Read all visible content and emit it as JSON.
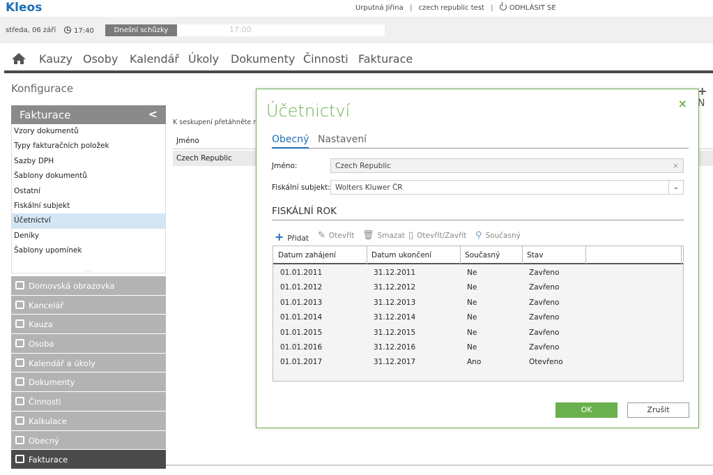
{
  "app": {
    "logo": "Kleos"
  },
  "header": {
    "user": "Urputná Jiřina",
    "org": "czech republic test",
    "logout": "ODHLÁSIT SE",
    "date": "středa, 06 září",
    "time": "17:40",
    "meetings_label": "Dnešní schůzky",
    "meetings_time": "17:00"
  },
  "nav": {
    "items": [
      "Kauzy",
      "Osoby",
      "Kalendář",
      "Úkoly",
      "Dokumenty",
      "Činnosti",
      "Fakturace"
    ]
  },
  "page": {
    "title": "Konfigurace",
    "add_partial": "N"
  },
  "sidebar": {
    "header": "Fakturace",
    "items": [
      "Vzory dokumentů",
      "Typy fakturačních položek",
      "Sazby DPH",
      "Šablony dokumentů",
      "Ostatní",
      "Fiskální subjekt",
      "Účetnictví",
      "Deníky",
      "Šablony upomínek"
    ],
    "active_item": "Účetnictví",
    "modules": [
      "Domovská obrazovka",
      "Kancelář",
      "Kauza",
      "Osoba",
      "Kalendář a úkoly",
      "Dokumenty",
      "Činnosti",
      "Kalkulace",
      "Obecný",
      "Fakturace"
    ],
    "active_module": "Fakturace"
  },
  "main": {
    "hint": "K seskupení přetáhněte n",
    "col_name": "Jméno",
    "row_value": "Czech Republic"
  },
  "modal": {
    "title": "Účetnictví",
    "close": "×",
    "tabs": [
      "Obecný",
      "Nastavení"
    ],
    "name_label": "Jméno:",
    "name_value": "Czech Republic",
    "fiscal_label": "Fiskální subjekt:",
    "fiscal_value": "Wolters Kluwer ČR",
    "section_title": "FISKÁLNÍ ROK",
    "toolbar": {
      "add": "Přidat",
      "open": "Otevřít",
      "delete": "Smazat",
      "open_close": "Otevřít/Zavřít",
      "current": "Současný"
    },
    "columns": [
      "Datum zahájení",
      "Datum ukončení",
      "Současný",
      "Stav"
    ],
    "rows": [
      [
        "01.01.2011",
        "31.12.2011",
        "Ne",
        "Zavřeno"
      ],
      [
        "01.01.2012",
        "31.12.2012",
        "Ne",
        "Zavřeno"
      ],
      [
        "01.01.2013",
        "31.12.2013",
        "Ne",
        "Zavřeno"
      ],
      [
        "01.01.2014",
        "31.12.2014",
        "Ne",
        "Zavřeno"
      ],
      [
        "01.01.2015",
        "31.12.2015",
        "Ne",
        "Zavřeno"
      ],
      [
        "01.01.2016",
        "31.12.2016",
        "Ne",
        "Zavřeno"
      ],
      [
        "01.01.2017",
        "31.12.2017",
        "Ano",
        "Otevřeno"
      ]
    ],
    "ok": "OK",
    "cancel": "Zrušit"
  },
  "colors": {
    "accent_green": "#6ab04c",
    "accent_blue": "#1c6fb8",
    "sidebar_active": "#d4e5f3"
  }
}
